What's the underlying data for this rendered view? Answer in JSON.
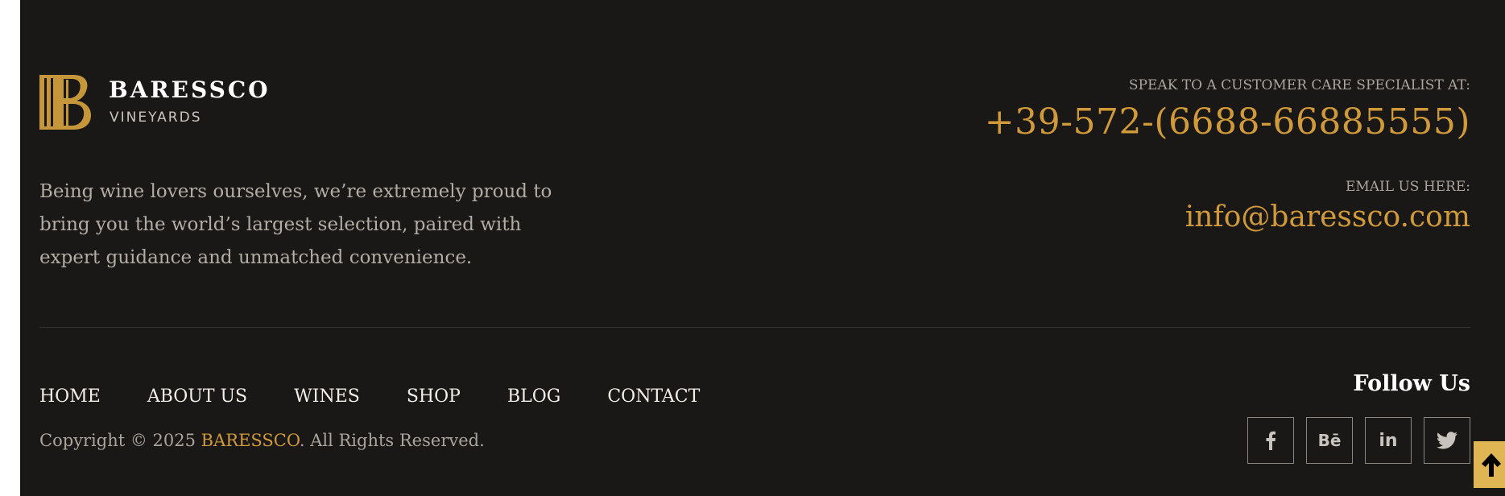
{
  "brand": {
    "name": "BARESSCO",
    "sub": "VINEYARDS"
  },
  "tagline": "Being wine lovers ourselves, we’re extremely proud to bring you the world’s largest selection, paired with expert guidance and unmatched convenience.",
  "contact": {
    "phone_label": "SPEAK TO A CUSTOMER CARE SPECIALIST AT:",
    "phone": "+39-572-(6688-66885555)",
    "email_label": "EMAIL US HERE:",
    "email": "info@baressco.com"
  },
  "nav": [
    "HOME",
    "ABOUT US",
    "WINES",
    "SHOP",
    "BLOG",
    "CONTACT"
  ],
  "copyright": {
    "prefix": "Copyright © 2025 ",
    "brand": "BARESSCO",
    "suffix": ". All Rights Reserved."
  },
  "follow": {
    "title": "Follow Us",
    "icons": [
      "facebook-icon",
      "behance-icon",
      "linkedin-icon",
      "twitter-icon"
    ],
    "behance_glyph": "Bē",
    "linkedin_glyph": "in"
  },
  "colors": {
    "background": "#191817",
    "accent": "#d0993a",
    "scroll_top": "#e0b553"
  }
}
